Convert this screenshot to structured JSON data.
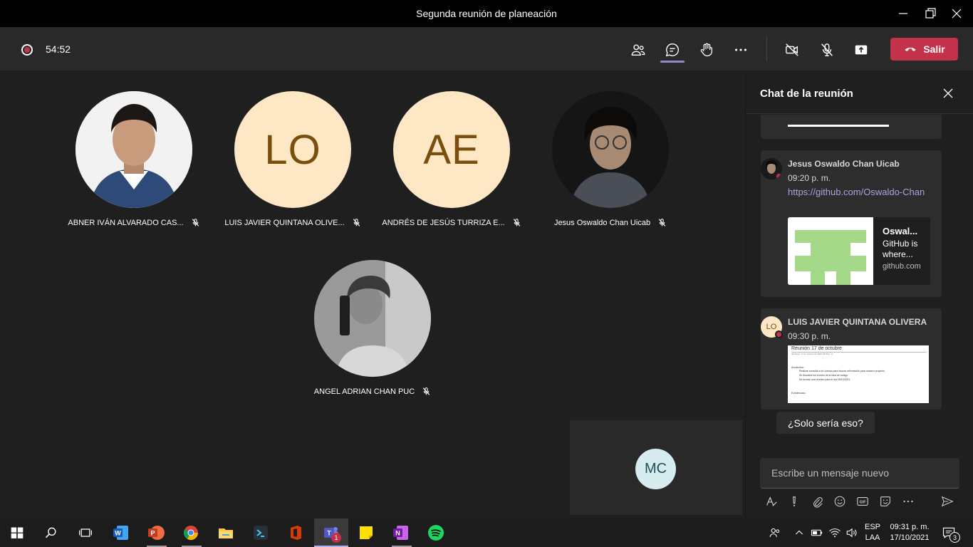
{
  "window": {
    "title": "Segunda reunión de planeación"
  },
  "meeting": {
    "timer": "54:52",
    "leave_label": "Salir"
  },
  "participants": [
    {
      "name": "ABNER IVÁN ALVARADO CAS...",
      "avatar": "photo"
    },
    {
      "name": "LUIS JAVIER QUINTANA OLIVE...",
      "initials": "LO"
    },
    {
      "name": "ANDRÉS DE JESÚS TURRIZA E...",
      "initials": "AE"
    },
    {
      "name": "Jesus Oswaldo Chan Uicab",
      "avatar": "photo"
    },
    {
      "name": "ANGEL ADRIAN CHAN PUC",
      "avatar": "photo"
    }
  ],
  "self_view": {
    "initials": "MC"
  },
  "chat": {
    "title": "Chat de la reunión",
    "messages": [
      {
        "sender": "Jesus Oswaldo Chan Uicab",
        "time": "09:20 p. m.",
        "link": "https://github.com/Oswaldo-Chan",
        "preview": {
          "title": "Oswal...",
          "desc": "GitHub is where...",
          "domain": "github.com"
        }
      },
      {
        "sender": "LUIS JAVIER QUINTANA OLIVERA",
        "sender_initials": "LO",
        "time": "09:30 p. m.",
        "doc": {
          "title": "Reunión 17 de octubre",
          "subtitle": "domingo, 17 de octubre de 2021    09:15 p. m.",
          "heading": "Acuerdos:",
          "bullets": [
            "Realizar consulta a la Unimod para buscar información para nuestro proyecto",
            "Se discutirá los errores de la idea de código",
            "Se acordó una reunión para el día 18/10/2021"
          ],
          "footer": "Evidencias:"
        }
      }
    ],
    "reply": "¿Solo sería eso?",
    "compose_placeholder": "Escribe un mensaje nuevo"
  },
  "taskbar": {
    "teams_badge": "1",
    "lang_line1": "ESP",
    "lang_line2": "LAA",
    "clock_time": "09:31 p. m.",
    "clock_date": "17/10/2021",
    "notif_count": "3"
  },
  "colors": {
    "accent_red": "#c4314b",
    "accent_purple": "#8b8cc7",
    "avatar_bg": "#fde7c4",
    "avatar_text": "#7a4f0e"
  }
}
